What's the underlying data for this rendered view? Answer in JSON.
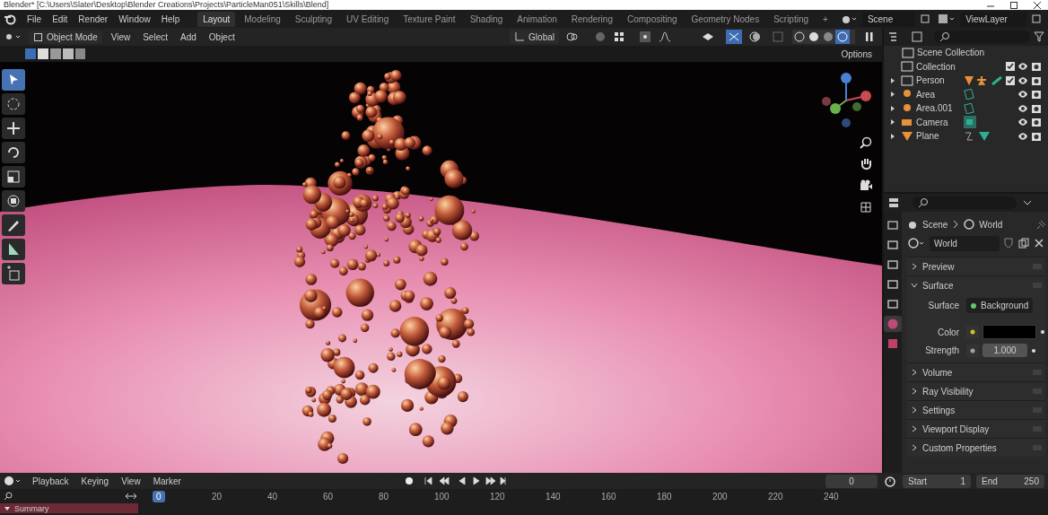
{
  "title_bar": {
    "title": "Blender* [C:\\Users\\Slater\\Desktop\\Blender Creations\\Projects\\ParticleMan051\\Skills\\Blend]"
  },
  "menu": [
    "File",
    "Edit",
    "Render",
    "Window",
    "Help"
  ],
  "workspaces": [
    {
      "label": "Layout",
      "selected": true
    },
    {
      "label": "Modeling",
      "selected": false
    },
    {
      "label": "Sculpting",
      "selected": false
    },
    {
      "label": "UV Editing",
      "selected": false
    },
    {
      "label": "Texture Paint",
      "selected": false
    },
    {
      "label": "Shading",
      "selected": false
    },
    {
      "label": "Animation",
      "selected": false
    },
    {
      "label": "Rendering",
      "selected": false
    },
    {
      "label": "Compositing",
      "selected": false
    },
    {
      "label": "Geometry Nodes",
      "selected": false
    },
    {
      "label": "Scripting",
      "selected": false
    }
  ],
  "add_workspace": "+",
  "scene": "Scene",
  "view_layer": "ViewLayer",
  "viewport": {
    "mode": "Object Mode",
    "menus": [
      "View",
      "Select",
      "Add",
      "Object"
    ],
    "orientation": "Global",
    "options": "Options",
    "tools": [
      {
        "kind": "select",
        "selected": true
      },
      {
        "kind": "cursor",
        "selected": false
      },
      {
        "kind": "move",
        "selected": false
      },
      {
        "kind": "rotate",
        "selected": false
      },
      {
        "kind": "scale",
        "selected": false
      },
      {
        "kind": "transform",
        "selected": false
      },
      {
        "kind": "annotate",
        "selected": false
      },
      {
        "kind": "measure",
        "selected": false
      },
      {
        "kind": "add-cube",
        "selected": false
      }
    ]
  },
  "outliner": {
    "root": "Scene Collection",
    "items": [
      {
        "name": "Collection",
        "kind": "collection",
        "checked": true
      },
      {
        "name": "Person",
        "kind": "group",
        "expanded": false,
        "checked": true
      },
      {
        "name": "Area",
        "kind": "light",
        "expanded": false
      },
      {
        "name": "Area.001",
        "kind": "light",
        "expanded": false
      },
      {
        "name": "Camera",
        "kind": "camera",
        "expanded": false
      },
      {
        "name": "Plane",
        "kind": "mesh",
        "expanded": false
      }
    ]
  },
  "properties": {
    "tabs": [
      {
        "kind": "tool",
        "selected": false
      },
      {
        "kind": "render",
        "selected": false
      },
      {
        "kind": "output",
        "selected": false
      },
      {
        "kind": "view-layer",
        "selected": false
      },
      {
        "kind": "scene",
        "selected": false
      },
      {
        "kind": "world",
        "selected": true
      },
      {
        "kind": "texture",
        "selected": false
      }
    ],
    "breadcrumb": [
      "Scene",
      "World"
    ],
    "datablock": "World",
    "panels": [
      {
        "title": "Preview",
        "expanded": false
      },
      {
        "title": "Surface",
        "expanded": true
      },
      {
        "title": "Volume",
        "expanded": false
      },
      {
        "title": "Ray Visibility",
        "expanded": false
      },
      {
        "title": "Settings",
        "expanded": false
      },
      {
        "title": "Viewport Display",
        "expanded": false
      },
      {
        "title": "Custom Properties",
        "expanded": false
      }
    ],
    "surface": {
      "surface_label": "Surface",
      "surface_value": "Background",
      "color_label": "Color",
      "color": "#000000",
      "strength_label": "Strength",
      "strength": "1.000"
    }
  },
  "timeline": {
    "menus": [
      "Playback",
      "Keying",
      "View",
      "Marker"
    ],
    "current_frame": "0",
    "start_label": "Start",
    "start": "1",
    "end_label": "End",
    "end": "250",
    "ruler": [
      {
        "label": "0",
        "selected": true
      },
      {
        "label": "20",
        "selected": false
      },
      {
        "label": "40",
        "selected": false
      },
      {
        "label": "60",
        "selected": false
      },
      {
        "label": "80",
        "selected": false
      },
      {
        "label": "100",
        "selected": false
      },
      {
        "label": "120",
        "selected": false
      },
      {
        "label": "140",
        "selected": false
      },
      {
        "label": "160",
        "selected": false
      },
      {
        "label": "180",
        "selected": false
      },
      {
        "label": "200",
        "selected": false
      },
      {
        "label": "220",
        "selected": false
      },
      {
        "label": "240",
        "selected": false
      }
    ],
    "channel": "Summary"
  }
}
